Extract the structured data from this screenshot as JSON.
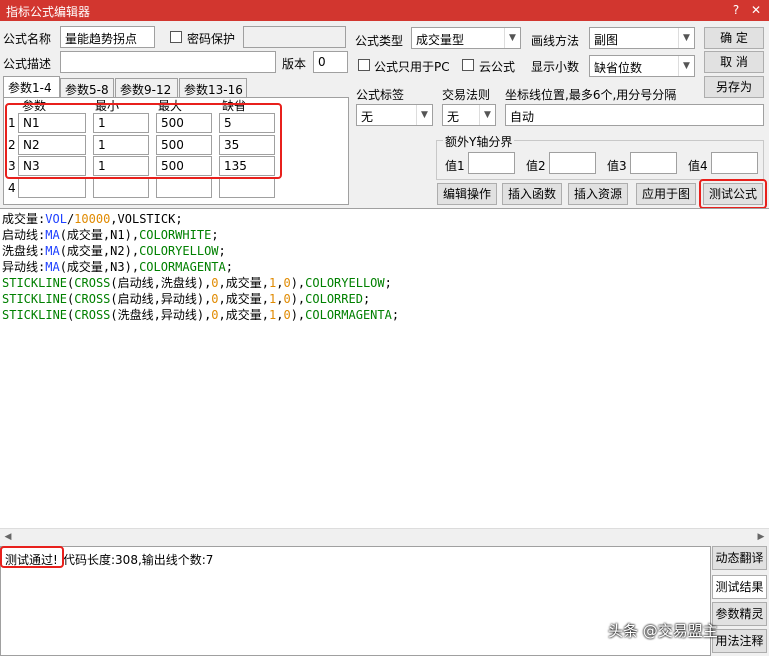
{
  "window": {
    "title": "指标公式编辑器",
    "help": "?",
    "close": "✕"
  },
  "form": {
    "name_label": "公式名称",
    "name_value": "量能趋势拐点",
    "password_label": "密码保护",
    "password_value": "",
    "desc_label": "公式描述",
    "desc_value": "",
    "version_label": "版本",
    "version_value": "0",
    "type_label": "公式类型",
    "type_value": "成交量型",
    "draw_label": "画线方法",
    "draw_value": "副图",
    "pc_only_label": "公式只用于PC",
    "cloud_label": "云公式",
    "decimals_label": "显示小数",
    "decimals_value": "缺省位数",
    "ok": "确  定",
    "cancel": "取  消",
    "save_as": "另存为"
  },
  "params": {
    "tabs": [
      "参数1-4",
      "参数5-8",
      "参数9-12",
      "参数13-16"
    ],
    "headers": [
      "参数",
      "最小",
      "最大",
      "缺省"
    ],
    "rows": [
      {
        "num": "1",
        "name": "N1",
        "min": "1",
        "max": "500",
        "default": "5"
      },
      {
        "num": "2",
        "name": "N2",
        "min": "1",
        "max": "500",
        "default": "35"
      },
      {
        "num": "3",
        "name": "N3",
        "min": "1",
        "max": "500",
        "default": "135"
      },
      {
        "num": "4",
        "name": "",
        "min": "",
        "max": "",
        "default": ""
      }
    ]
  },
  "right": {
    "tag_label": "公式标签",
    "tag_value": "无",
    "trade_label": "交易法则",
    "trade_value": "无",
    "coord_label": "坐标线位置,最多6个,用分号分隔",
    "coord_value": "自动",
    "yaxis_label": "额外Y轴分界",
    "values": [
      "值1",
      "值2",
      "值3",
      "值4"
    ]
  },
  "actions": [
    "编辑操作",
    "插入函数",
    "插入资源",
    "应用于图",
    "测试公式"
  ],
  "code": [
    [
      [
        "成交量",
        "#000000"
      ],
      [
        ":",
        "#000000"
      ],
      [
        "VOL",
        "#1e40ff"
      ],
      [
        "/",
        "#000000"
      ],
      [
        "10000",
        "#e08a00"
      ],
      [
        ",VOLSTICK;",
        "#000000"
      ]
    ],
    [
      [
        "启动线",
        "#000000"
      ],
      [
        ":",
        "#000000"
      ],
      [
        "MA",
        "#1e40ff"
      ],
      [
        "(成交量,N1),",
        "#000000"
      ],
      [
        "COLORWHITE",
        "#008000"
      ],
      [
        ";",
        "#000000"
      ]
    ],
    [
      [
        "洗盘线",
        "#000000"
      ],
      [
        ":",
        "#000000"
      ],
      [
        "MA",
        "#1e40ff"
      ],
      [
        "(成交量,N2),",
        "#000000"
      ],
      [
        "COLORYELLOW",
        "#008000"
      ],
      [
        ";",
        "#000000"
      ]
    ],
    [
      [
        "异动线",
        "#000000"
      ],
      [
        ":",
        "#000000"
      ],
      [
        "MA",
        "#1e40ff"
      ],
      [
        "(成交量,N3),",
        "#000000"
      ],
      [
        "COLORMAGENTA",
        "#008000"
      ],
      [
        ";",
        "#000000"
      ]
    ],
    [
      [
        "STICKLINE",
        "#008000"
      ],
      [
        "(",
        "#000000"
      ],
      [
        "CROSS",
        "#008000"
      ],
      [
        "(启动线,洗盘线),",
        "#000000"
      ],
      [
        "0",
        "#e08a00"
      ],
      [
        ",成交量,",
        "#000000"
      ],
      [
        "1",
        "#e08a00"
      ],
      [
        ",",
        "#000000"
      ],
      [
        "0",
        "#e08a00"
      ],
      [
        "),",
        "#000000"
      ],
      [
        "COLORYELLOW",
        "#008000"
      ],
      [
        ";",
        "#000000"
      ]
    ],
    [
      [
        "STICKLINE",
        "#008000"
      ],
      [
        "(",
        "#000000"
      ],
      [
        "CROSS",
        "#008000"
      ],
      [
        "(启动线,异动线),",
        "#000000"
      ],
      [
        "0",
        "#e08a00"
      ],
      [
        ",成交量,",
        "#000000"
      ],
      [
        "1",
        "#e08a00"
      ],
      [
        ",",
        "#000000"
      ],
      [
        "0",
        "#e08a00"
      ],
      [
        "),",
        "#000000"
      ],
      [
        "COLORRED",
        "#008000"
      ],
      [
        ";",
        "#000000"
      ]
    ],
    [
      [
        "STICKLINE",
        "#008000"
      ],
      [
        "(",
        "#000000"
      ],
      [
        "CROSS",
        "#008000"
      ],
      [
        "(洗盘线,异动线),",
        "#000000"
      ],
      [
        "0",
        "#e08a00"
      ],
      [
        ",成交量,",
        "#000000"
      ],
      [
        "1",
        "#e08a00"
      ],
      [
        ",",
        "#000000"
      ],
      [
        "0",
        "#e08a00"
      ],
      [
        "),",
        "#000000"
      ],
      [
        "COLORMAGENTA",
        "#008000"
      ],
      [
        ";",
        "#000000"
      ]
    ]
  ],
  "output": {
    "status": "测试通过!",
    "detail": "代码长度:308,输出线个数:7"
  },
  "side_buttons": [
    "动态翻译",
    "测试结果",
    "参数精灵",
    "用法注释"
  ],
  "watermark": "头条 @交易盟主",
  "colors": {
    "titlebar": "#d2362f",
    "highlight": "#e8201c"
  }
}
